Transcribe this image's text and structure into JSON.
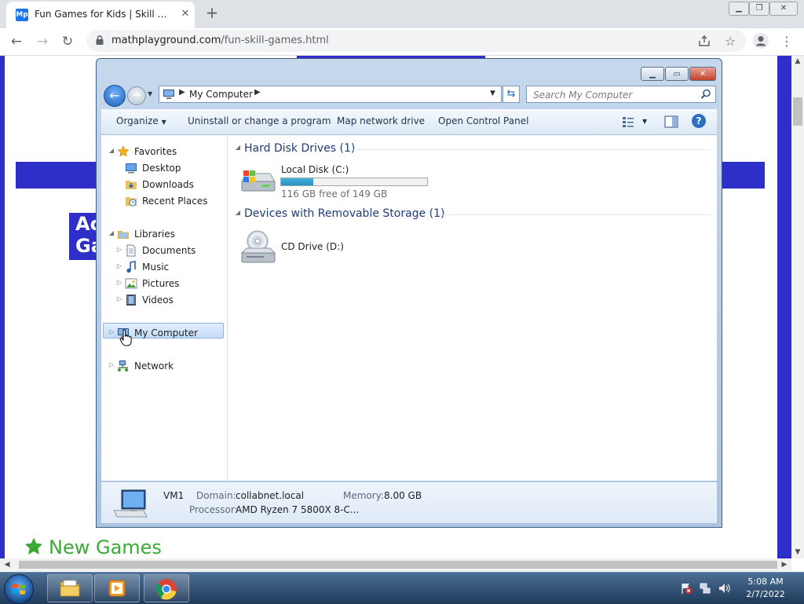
{
  "browser": {
    "tab_title": "Fun Games for Kids | Skill Games",
    "tab_favicon_text": "Mp",
    "url_host": "mathplayground.com",
    "url_path": "/fun-skill-games.html"
  },
  "webpage": {
    "tile_text": "Ac Ga",
    "new_games_label": "New Games"
  },
  "explorer": {
    "address": {
      "location": "My Computer"
    },
    "search_placeholder": "Search My Computer",
    "commands": {
      "organize": "Organize",
      "uninstall": "Uninstall or change a program",
      "map_drive": "Map network drive",
      "control_panel": "Open Control Panel"
    },
    "nav": {
      "favorites": "Favorites",
      "desktop": "Desktop",
      "downloads": "Downloads",
      "recent": "Recent Places",
      "libraries": "Libraries",
      "documents": "Documents",
      "music": "Music",
      "pictures": "Pictures",
      "videos": "Videos",
      "computer": "My Computer",
      "network": "Network"
    },
    "groups": {
      "hdd_title": "Hard Disk Drives (1)",
      "removable_title": "Devices with Removable Storage (1)"
    },
    "local_disk": {
      "name": "Local Disk (C:)",
      "free_text": "116 GB free of 149 GB",
      "used_fraction": 0.22
    },
    "cd_drive": {
      "name": "CD Drive (D:)"
    },
    "details": {
      "computer_name": "VM1",
      "domain_label": "Domain:",
      "domain_value": "collabnet.local",
      "memory_label": "Memory:",
      "memory_value": "8.00 GB",
      "processor_label": "Processor:",
      "processor_value": "AMD Ryzen 7 5800X 8-C..."
    }
  },
  "taskbar": {
    "time": "5:08 AM",
    "date": "2/7/2022"
  }
}
